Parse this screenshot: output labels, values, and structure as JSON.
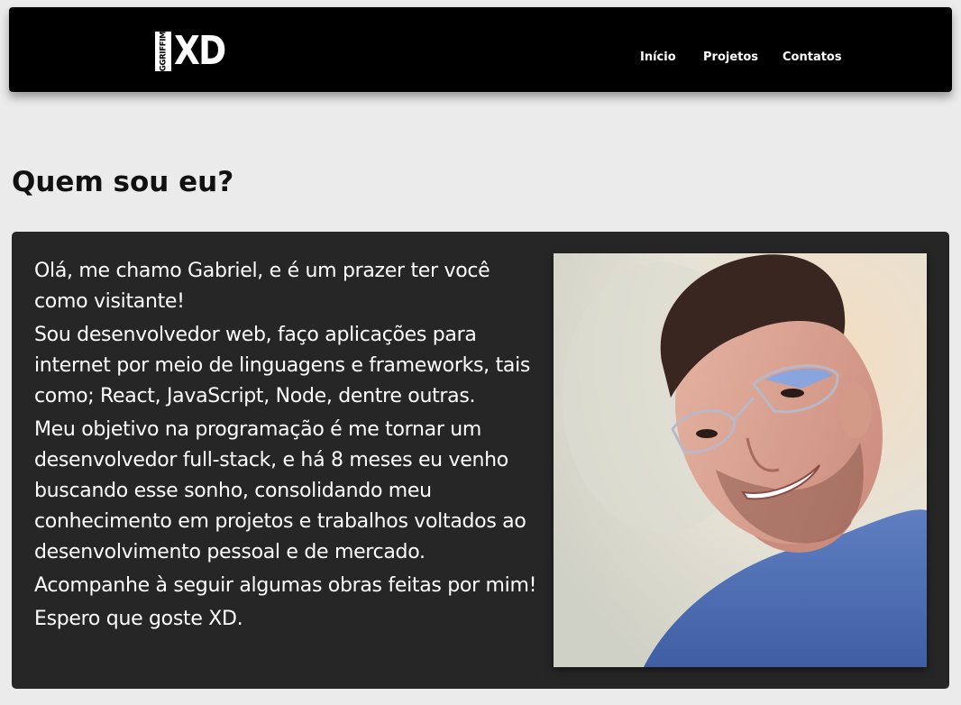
{
  "header": {
    "logo": {
      "side_text": "GGRIFFIM",
      "main_text": "XD"
    },
    "nav": [
      {
        "label": "Início"
      },
      {
        "label": "Projetos"
      },
      {
        "label": "Contatos"
      }
    ]
  },
  "main": {
    "title": "Quem sou eu?",
    "paragraphs": [
      "Olá, me chamo Gabriel, e é um prazer ter você como visitante!",
      "Sou desenvolvedor web, faço aplicações para internet por meio de linguagens e frameworks, tais como; React, JavaScript, Node, dentre outras.",
      "Meu objetivo na programação é me tornar um desenvolvedor full-stack, e há 8 meses eu venho buscando esse sonho, consolidando meu conhecimento em projetos e trabalhos voltados ao desenvolvimento pessoal e de mercado.",
      "Acompanhe à seguir algumas obras feitas por mim!",
      "Espero que goste XD."
    ]
  },
  "colors": {
    "page_bg": "#ebebeb",
    "header_bg": "#000000",
    "card_bg": "#262626",
    "text_light": "#ffffff"
  }
}
